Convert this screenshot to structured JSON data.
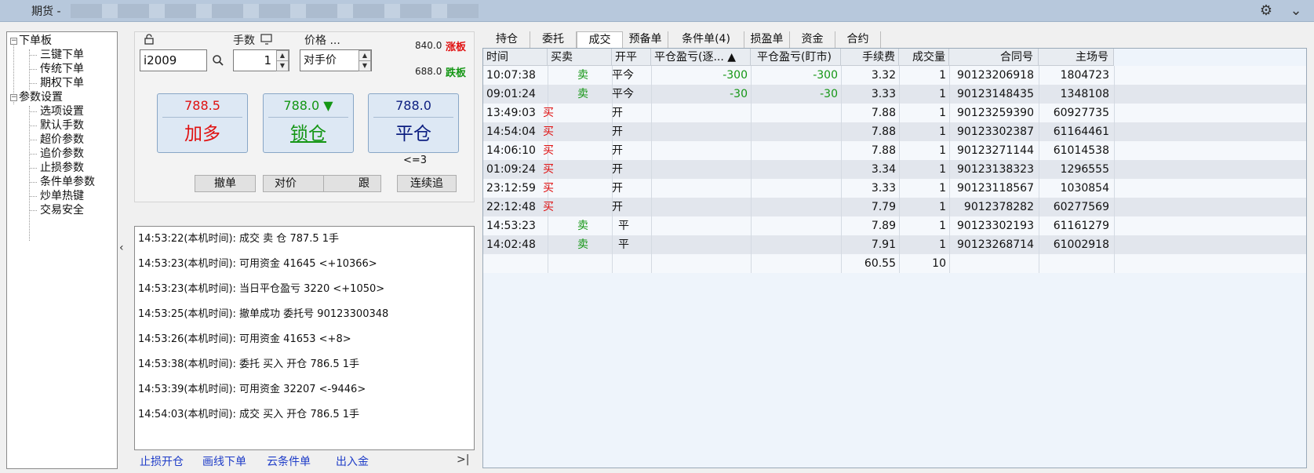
{
  "titlebar": {
    "title": "期货 -",
    "settings_icon": "gear-icon",
    "minimize_icon": "chevron-down-icon"
  },
  "tree": {
    "groups": [
      {
        "label": "下单板",
        "toggle": "⊟",
        "items": [
          "三键下单",
          "传统下单",
          "期权下单"
        ]
      },
      {
        "label": "参数设置",
        "toggle": "⊟",
        "items": [
          "选项设置",
          "默认手数",
          "超价参数",
          "追价参数",
          "止损参数",
          "条件单参数",
          "炒单热键",
          "交易安全"
        ]
      }
    ]
  },
  "collapse_glyph": "‹",
  "order": {
    "lock_icon": "lock-icon",
    "contract_value": "i2009",
    "search_icon": "search-icon",
    "qty_label": "手数",
    "qty_value": "1",
    "price_label": "价格 ...",
    "price_value": "对手价",
    "upper_limit_value": "840.0",
    "upper_limit_tag": "涨板",
    "lower_limit_value": "688.0",
    "lower_limit_tag": "跌板",
    "buttons": [
      {
        "price": "788.5",
        "action": "加多",
        "price_color": "#d81010",
        "action_color": "#d81010"
      },
      {
        "price": "788.0 ▼",
        "action": "锁仓",
        "price_color": "#149614",
        "action_color": "#149614"
      },
      {
        "price": "788.0",
        "action": "平仓",
        "price_color": "#0c1e80",
        "action_color": "#0c1e80"
      }
    ],
    "close_limit_note": "<=3",
    "small_buttons": [
      "撤单",
      "对价",
      "跟",
      "连续追"
    ]
  },
  "log": [
    "14:53:22(本机时间): 成交 卖 仓 787.5 1手",
    "14:53:23(本机时间): 可用资金 41645 <+10366>",
    "14:53:23(本机时间): 当日平仓盈亏 3220 <+1050>",
    "14:53:25(本机时间): 撤单成功 委托号 90123300348",
    "14:53:26(本机时间): 可用资金 41653 <+8>",
    "14:53:38(本机时间): 委托 买入 开仓 786.5 1手",
    "14:53:39(本机时间): 可用资金 32207 <-9446>",
    "14:54:03(本机时间): 成交 买入 开仓 786.5 1手"
  ],
  "bottom_links": [
    "止损开仓",
    "画线下单",
    "云条件单",
    "出入金",
    ">|"
  ],
  "tabs": [
    "持仓",
    "委托",
    "成交",
    "预备单",
    "条件单(4)",
    "损盈单",
    "资金",
    "合约"
  ],
  "active_tab": "成交",
  "grid": {
    "headers": [
      "时间",
      "买卖",
      "开平",
      "平仓盈亏(逐... ▲",
      "平仓盈亏(盯市)",
      "手续费",
      "成交量",
      "合同号",
      "主场号"
    ],
    "rows": [
      [
        "10:07:38",
        "卖",
        "平今",
        "-300",
        "-300",
        "3.32",
        "1",
        "90123206918",
        "1804723"
      ],
      [
        "09:01:24",
        "卖",
        "平今",
        "-30",
        "-30",
        "3.33",
        "1",
        "90123148435",
        "1348108"
      ],
      [
        "13:49:03",
        "买",
        "开",
        "",
        "",
        "7.88",
        "1",
        "90123259390",
        "60927735"
      ],
      [
        "14:54:04",
        "买",
        "开",
        "",
        "",
        "7.88",
        "1",
        "90123302387",
        "61164461"
      ],
      [
        "14:06:10",
        "买",
        "开",
        "",
        "",
        "7.88",
        "1",
        "90123271144",
        "61014538"
      ],
      [
        "01:09:24",
        "买",
        "开",
        "",
        "",
        "3.34",
        "1",
        "90123138323",
        "1296555"
      ],
      [
        "23:12:59",
        "买",
        "开",
        "",
        "",
        "3.33",
        "1",
        "90123118567",
        "1030854"
      ],
      [
        "22:12:48",
        "买",
        "开",
        "",
        "",
        "7.79",
        "1",
        "9012378282",
        "60277569"
      ],
      [
        "14:53:23",
        "卖",
        "平",
        "",
        "",
        "7.89",
        "1",
        "90123302193",
        "61161279"
      ],
      [
        "14:02:48",
        "卖",
        "平",
        "",
        "",
        "7.91",
        "1",
        "90123268714",
        "61002918"
      ]
    ],
    "total_fee": "60.55",
    "total_qty": "10"
  },
  "colors": {
    "buy": "#e01010",
    "sell": "#149614",
    "loss": "#149614",
    "link": "#1e3cc8"
  }
}
